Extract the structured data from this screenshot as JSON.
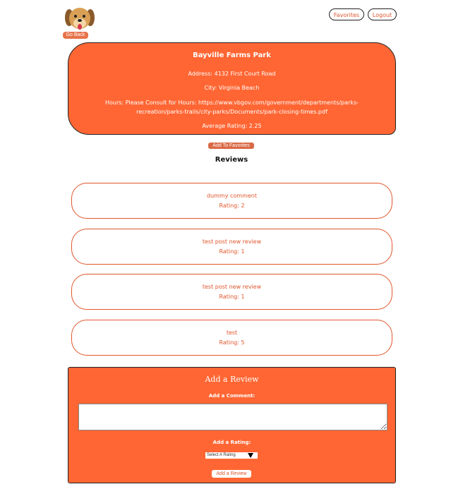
{
  "header": {
    "logo_icon": "dog-face-icon",
    "go_back_label": "Go Back",
    "favorites_label": "Favorites",
    "logout_label": "Logout"
  },
  "park": {
    "name": "Bayville Farms Park",
    "address": "Address: 4132 First Court Road",
    "city": "City: Virginia Beach",
    "hours": "Hours: Please Consult for Hours: https://www.vbgov.com/government/departments/parks-recreation/parks-trails/city-parks/Documents/park-closing-times.pdf",
    "average_rating": "Average Rating: 2.25"
  },
  "add_to_favorites_label": "Add To Favorites",
  "reviews_heading": "Reviews",
  "reviews": [
    {
      "comment": "dummy comment",
      "rating": "Rating: 2"
    },
    {
      "comment": "test post new review",
      "rating": "Rating: 1"
    },
    {
      "comment": "test post new review",
      "rating": "Rating: 1"
    },
    {
      "comment": "test",
      "rating": "Rating: 5"
    }
  ],
  "add_review": {
    "title": "Add a Review",
    "comment_label": "Add a Comment:",
    "comment_value": "",
    "rating_label": "Add a Rating:",
    "rating_selected": "Select A Rating",
    "submit_label": "Add a Review"
  },
  "colors": {
    "accent": "#ff6633",
    "accent_text": "#e0562c",
    "button_muted": "#d96a45"
  }
}
